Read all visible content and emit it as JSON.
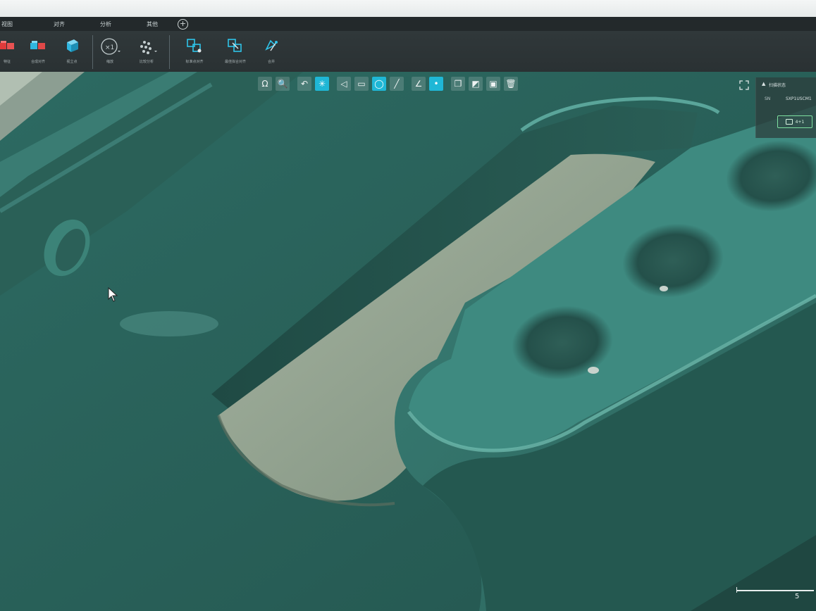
{
  "menu": {
    "items": [
      {
        "label": "视图"
      },
      {
        "label": "对齐"
      },
      {
        "label": "分析"
      },
      {
        "label": "其他"
      }
    ]
  },
  "ribbon": {
    "buttons": [
      {
        "label": "特征",
        "icon": "red-blocks-icon"
      },
      {
        "label": "合成对齐",
        "icon": "blue-blocks-icon"
      },
      {
        "label": "视立点",
        "icon": "cube-icon"
      },
      {
        "label": "缩放",
        "icon": "zoom-x1-icon"
      },
      {
        "label": "比较分析",
        "icon": "points-icon"
      },
      {
        "label": "标准点对齐",
        "icon": "align-icon"
      },
      {
        "label": "最佳拟合对齐",
        "icon": "best-fit-icon"
      },
      {
        "label": "合并",
        "icon": "merge-icon"
      }
    ]
  },
  "viewbar": {
    "tools": [
      {
        "icon": "omega-icon",
        "glyph": "Ω",
        "active": false
      },
      {
        "icon": "magnifier-icon",
        "glyph": "🔍",
        "active": false
      },
      {
        "icon": "curve-icon",
        "glyph": "↶",
        "active": false
      },
      {
        "icon": "sparkle-select-icon",
        "glyph": "✳",
        "active": true
      },
      {
        "icon": "lasso-poly-icon",
        "glyph": "◁",
        "active": false
      },
      {
        "icon": "rect-select-icon",
        "glyph": "▭",
        "active": false
      },
      {
        "icon": "ellipse-select-icon",
        "glyph": "◯",
        "active": true
      },
      {
        "icon": "brush-icon",
        "glyph": "╱",
        "active": false
      },
      {
        "icon": "angle-icon",
        "glyph": "∠",
        "active": false
      },
      {
        "icon": "point-icon",
        "glyph": "•",
        "active": true
      },
      {
        "icon": "copy-icon",
        "glyph": "❐",
        "active": false
      },
      {
        "icon": "invert-icon",
        "glyph": "◩",
        "active": false
      },
      {
        "icon": "box-icon",
        "glyph": "▣",
        "active": false
      },
      {
        "icon": "trash-icon",
        "glyph": "🗑",
        "active": false
      }
    ]
  },
  "panel": {
    "title": "扫描状态",
    "sn_label": "SN",
    "sn_value": "SXP1USCM1",
    "badge": "4+1"
  },
  "scale": {
    "label": "5"
  },
  "colors": {
    "accent": "#1fb7d6",
    "model": "#2f6f66",
    "background": "#202628"
  }
}
